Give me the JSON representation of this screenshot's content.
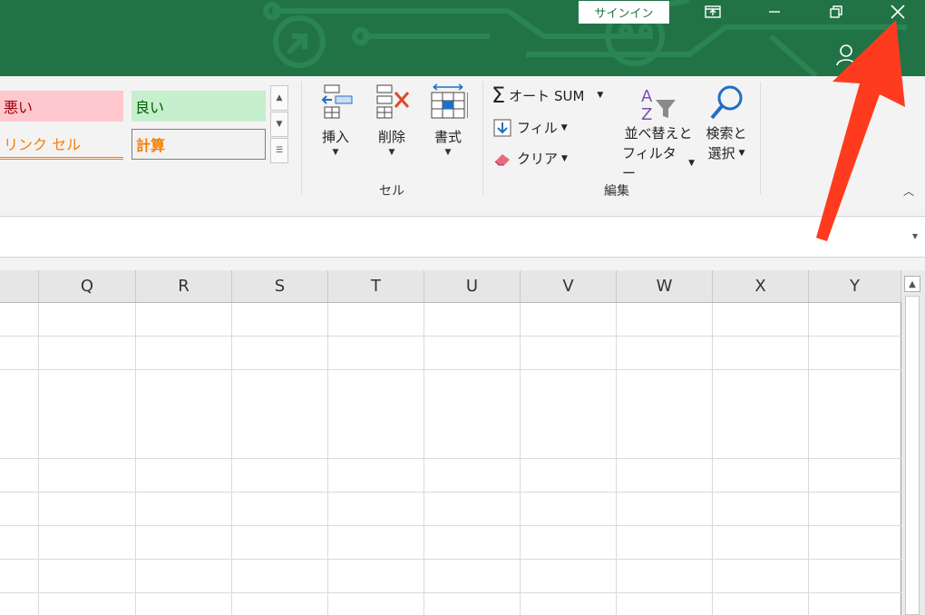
{
  "title_bar": {
    "signin_label": "サインイン",
    "buttons": [
      "ribbon-display-options",
      "minimize",
      "restore",
      "close"
    ]
  },
  "styles_gallery": {
    "bad": "悪い",
    "good": "良い",
    "linked_cell": "リンク セル",
    "calculation": "計算"
  },
  "cells_group": {
    "insert": "挿入",
    "delete": "削除",
    "format": "書式",
    "label": "セル"
  },
  "editing_group": {
    "autosum": "オート SUM",
    "fill": "フィル",
    "clear": "クリア",
    "sort_filter_line1": "並べ替えと",
    "sort_filter_line2": "フィルター",
    "find_select_line1": "検索と",
    "find_select_line2": "選択",
    "label": "編集"
  },
  "columns": [
    "Q",
    "R",
    "S",
    "T",
    "U",
    "V",
    "W",
    "X",
    "Y"
  ],
  "colors": {
    "title_green": "#217346",
    "bad_bg": "#ffc7ce",
    "bad_text": "#9c0006",
    "good_bg": "#c6efce",
    "good_text": "#006100",
    "calc_text": "#fa7d00",
    "arrow_red": "#ff3b1f"
  }
}
